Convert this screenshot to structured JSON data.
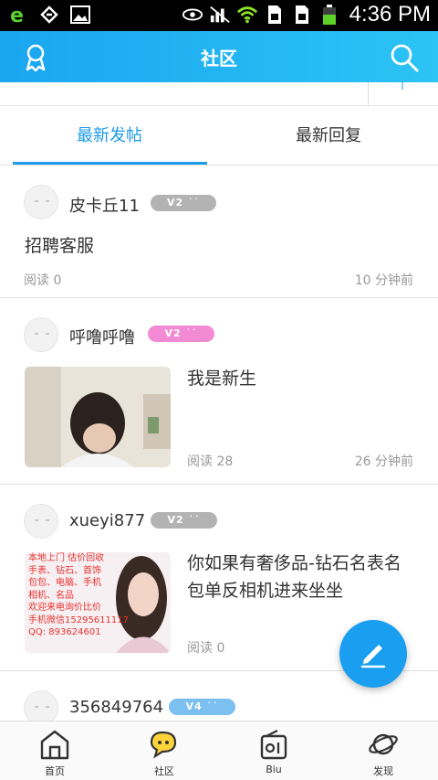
{
  "status_bar": {
    "time": "4:36 PM"
  },
  "header": {
    "title": "社区",
    "left_icon": "user-rank-icon",
    "right_icon": "search-icon",
    "color": "#1aa6f0"
  },
  "tabs": [
    {
      "label": "最新发帖",
      "active": true
    },
    {
      "label": "最新回复",
      "active": false
    }
  ],
  "posts": [
    {
      "username": "皮卡丘11",
      "level": "V2",
      "level_color": "#b3b3b3",
      "title": "招聘客服",
      "reads": "阅读 0",
      "time": "10 分钟前"
    },
    {
      "username": "呼噜呼噜",
      "level": "V2",
      "level_color": "#f38ad4",
      "title": "我是新生",
      "reads": "阅读 28",
      "time": "26 分钟前",
      "has_image": true
    },
    {
      "username": "xueyi877",
      "level": "V2",
      "level_color": "#b3b3b3",
      "title": "你如果有奢侈品-钻石名表名包单反相机进来坐坐",
      "reads": "阅读 0",
      "time": "",
      "image_text": [
        "本地上门 估价回收",
        "手表、钻石、首饰",
        "包包、电脑、手机",
        "相机、名品",
        "欢迎来电询价比价",
        "手机微信15295611117",
        "QQ: 893624601"
      ]
    },
    {
      "username": "356849764",
      "level": "V4",
      "level_color": "#7cc0f2"
    }
  ],
  "bottom_nav": [
    {
      "label": "首页",
      "icon": "home-icon"
    },
    {
      "label": "社区",
      "icon": "community-chat-icon",
      "active": true
    },
    {
      "label": "Biu",
      "icon": "radio-icon"
    },
    {
      "label": "发现",
      "icon": "planet-icon"
    }
  ],
  "fab": {
    "icon": "pencil-icon"
  }
}
